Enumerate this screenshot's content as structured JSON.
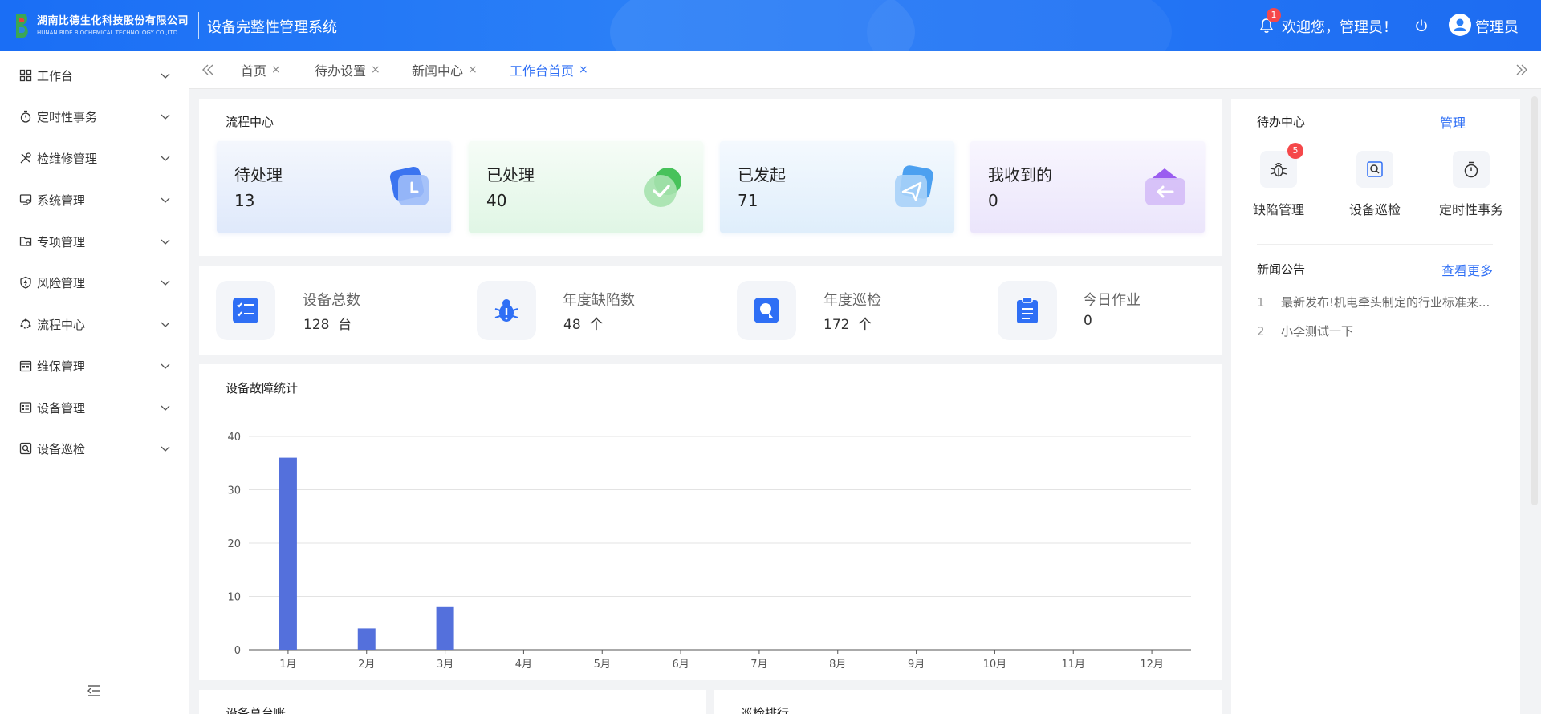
{
  "header": {
    "company_cn": "湖南比德生化科技股份有限公司",
    "company_en": "HUNAN BIDE BIOCHEMICAL TECHNOLOGY CO.,LTD.",
    "system_title": "设备完整性管理系统",
    "notification_count": "1",
    "welcome_text": "欢迎您，管理员！",
    "user_name": "管理员"
  },
  "sidebar": {
    "items": [
      {
        "label": "工作台",
        "icon": "grid-icon"
      },
      {
        "label": "定时性事务",
        "icon": "stopwatch-icon"
      },
      {
        "label": "检维修管理",
        "icon": "tools-icon"
      },
      {
        "label": "系统管理",
        "icon": "monitor-gear-icon"
      },
      {
        "label": "专项管理",
        "icon": "folder-gear-icon"
      },
      {
        "label": "风险管理",
        "icon": "shield-icon"
      },
      {
        "label": "流程中心",
        "icon": "cycle-icon"
      },
      {
        "label": "维保管理",
        "icon": "calendar-icon"
      },
      {
        "label": "设备管理",
        "icon": "list-card-icon"
      },
      {
        "label": "设备巡检",
        "icon": "search-box-icon"
      }
    ]
  },
  "tabs": [
    {
      "label": "首页",
      "active": false
    },
    {
      "label": "待办设置",
      "active": false
    },
    {
      "label": "新闻中心",
      "active": false
    },
    {
      "label": "工作台首页",
      "active": true
    }
  ],
  "flow_center": {
    "title": "流程中心",
    "boxes": [
      {
        "label": "待处理",
        "value": "13"
      },
      {
        "label": "已处理",
        "value": "40"
      },
      {
        "label": "已发起",
        "value": "71"
      },
      {
        "label": "我收到的",
        "value": "0"
      }
    ]
  },
  "stats": [
    {
      "label": "设备总数",
      "value": "128",
      "unit": "台"
    },
    {
      "label": "年度缺陷数",
      "value": "48",
      "unit": "个"
    },
    {
      "label": "年度巡检",
      "value": "172",
      "unit": "个"
    },
    {
      "label": "今日作业",
      "value": "0",
      "unit": ""
    }
  ],
  "todo_center": {
    "title": "待办中心",
    "manage_link": "管理",
    "items": [
      {
        "label": "缺陷管理",
        "badge": "5"
      },
      {
        "label": "设备巡检",
        "badge": ""
      },
      {
        "label": "定时性事务",
        "badge": ""
      }
    ]
  },
  "news": {
    "title": "新闻公告",
    "more_link": "查看更多",
    "items": [
      {
        "num": "1",
        "text": "最新发布!机电牵头制定的行业标准来..."
      },
      {
        "num": "2",
        "text": "小李测试一下"
      }
    ]
  },
  "bottom_cards": {
    "left_title": "设备总台账",
    "right_title": "巡检排行"
  },
  "colors": {
    "primary": "#2f6ff5",
    "bar": "#5470dc",
    "badge": "#f5484a"
  },
  "chart_data": {
    "type": "bar",
    "title": "设备故障统计",
    "categories": [
      "1月",
      "2月",
      "3月",
      "4月",
      "5月",
      "6月",
      "7月",
      "8月",
      "9月",
      "10月",
      "11月",
      "12月"
    ],
    "values": [
      36,
      4,
      8,
      0,
      0,
      0,
      0,
      0,
      0,
      0,
      0,
      0
    ],
    "yticks": [
      "0",
      "10",
      "20",
      "30",
      "40"
    ],
    "ylim": [
      0,
      40
    ],
    "grid": true,
    "legend": "none"
  }
}
